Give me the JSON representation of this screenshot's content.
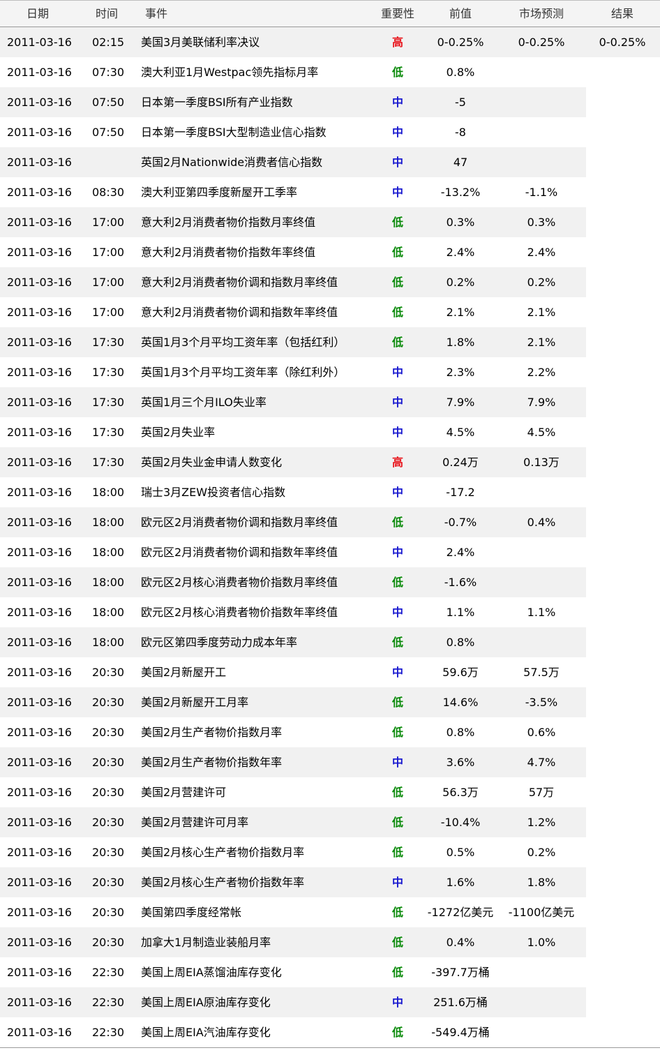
{
  "table": {
    "headers": {
      "date": "日期",
      "time": "时间",
      "event": "事件",
      "importance": "重要性",
      "previous": "前值",
      "forecast": "市场预测",
      "result": "结果"
    },
    "importance_colors": {
      "high": "#e8141b",
      "mid": "#1818cf",
      "low": "#0a8a0a"
    },
    "rows": [
      {
        "date": "2011-03-16",
        "time": "02:15",
        "event": "美国3月美联储利率决议",
        "importance": "高",
        "level": "high",
        "previous": "0-0.25%",
        "forecast": "0-0.25%",
        "result": "0-0.25%"
      },
      {
        "date": "2011-03-16",
        "time": "07:30",
        "event": "澳大利亚1月Westpac领先指标月率",
        "importance": "低",
        "level": "low",
        "previous": "0.8%",
        "forecast": "",
        "result": ""
      },
      {
        "date": "2011-03-16",
        "time": "07:50",
        "event": "日本第一季度BSI所有产业指数",
        "importance": "中",
        "level": "mid",
        "previous": "-5",
        "forecast": "",
        "result": ""
      },
      {
        "date": "2011-03-16",
        "time": "07:50",
        "event": "日本第一季度BSI大型制造业信心指数",
        "importance": "中",
        "level": "mid",
        "previous": "-8",
        "forecast": "",
        "result": ""
      },
      {
        "date": "2011-03-16",
        "time": "",
        "event": "英国2月Nationwide消费者信心指数",
        "importance": "中",
        "level": "mid",
        "previous": "47",
        "forecast": "",
        "result": ""
      },
      {
        "date": "2011-03-16",
        "time": "08:30",
        "event": "澳大利亚第四季度新屋开工季率",
        "importance": "中",
        "level": "mid",
        "previous": "-13.2%",
        "forecast": "-1.1%",
        "result": ""
      },
      {
        "date": "2011-03-16",
        "time": "17:00",
        "event": "意大利2月消费者物价指数月率终值",
        "importance": "低",
        "level": "low",
        "previous": "0.3%",
        "forecast": "0.3%",
        "result": ""
      },
      {
        "date": "2011-03-16",
        "time": "17:00",
        "event": "意大利2月消费者物价指数年率终值",
        "importance": "低",
        "level": "low",
        "previous": "2.4%",
        "forecast": "2.4%",
        "result": ""
      },
      {
        "date": "2011-03-16",
        "time": "17:00",
        "event": "意大利2月消费者物价调和指数月率终值",
        "importance": "低",
        "level": "low",
        "previous": "0.2%",
        "forecast": "0.2%",
        "result": ""
      },
      {
        "date": "2011-03-16",
        "time": "17:00",
        "event": "意大利2月消费者物价调和指数年率终值",
        "importance": "低",
        "level": "low",
        "previous": "2.1%",
        "forecast": "2.1%",
        "result": ""
      },
      {
        "date": "2011-03-16",
        "time": "17:30",
        "event": "英国1月3个月平均工资年率（包括红利）",
        "importance": "低",
        "level": "low",
        "previous": "1.8%",
        "forecast": "2.1%",
        "result": ""
      },
      {
        "date": "2011-03-16",
        "time": "17:30",
        "event": "英国1月3个月平均工资年率（除红利外）",
        "importance": "中",
        "level": "mid",
        "previous": "2.3%",
        "forecast": "2.2%",
        "result": ""
      },
      {
        "date": "2011-03-16",
        "time": "17:30",
        "event": "英国1月三个月ILO失业率",
        "importance": "中",
        "level": "mid",
        "previous": "7.9%",
        "forecast": "7.9%",
        "result": ""
      },
      {
        "date": "2011-03-16",
        "time": "17:30",
        "event": "英国2月失业率",
        "importance": "中",
        "level": "mid",
        "previous": "4.5%",
        "forecast": "4.5%",
        "result": ""
      },
      {
        "date": "2011-03-16",
        "time": "17:30",
        "event": "英国2月失业金申请人数变化",
        "importance": "高",
        "level": "high",
        "previous": "0.24万",
        "forecast": "0.13万",
        "result": ""
      },
      {
        "date": "2011-03-16",
        "time": "18:00",
        "event": "瑞士3月ZEW投资者信心指数",
        "importance": "中",
        "level": "mid",
        "previous": "-17.2",
        "forecast": "",
        "result": ""
      },
      {
        "date": "2011-03-16",
        "time": "18:00",
        "event": "欧元区2月消费者物价调和指数月率终值",
        "importance": "低",
        "level": "low",
        "previous": "-0.7%",
        "forecast": "0.4%",
        "result": ""
      },
      {
        "date": "2011-03-16",
        "time": "18:00",
        "event": "欧元区2月消费者物价调和指数年率终值",
        "importance": "中",
        "level": "mid",
        "previous": "2.4%",
        "forecast": "",
        "result": ""
      },
      {
        "date": "2011-03-16",
        "time": "18:00",
        "event": "欧元区2月核心消费者物价指数月率终值",
        "importance": "低",
        "level": "low",
        "previous": "-1.6%",
        "forecast": "",
        "result": ""
      },
      {
        "date": "2011-03-16",
        "time": "18:00",
        "event": "欧元区2月核心消费者物价指数年率终值",
        "importance": "中",
        "level": "mid",
        "previous": "1.1%",
        "forecast": "1.1%",
        "result": ""
      },
      {
        "date": "2011-03-16",
        "time": "18:00",
        "event": "欧元区第四季度劳动力成本年率",
        "importance": "低",
        "level": "low",
        "previous": "0.8%",
        "forecast": "",
        "result": ""
      },
      {
        "date": "2011-03-16",
        "time": "20:30",
        "event": "美国2月新屋开工",
        "importance": "中",
        "level": "mid",
        "previous": "59.6万",
        "forecast": "57.5万",
        "result": ""
      },
      {
        "date": "2011-03-16",
        "time": "20:30",
        "event": "美国2月新屋开工月率",
        "importance": "低",
        "level": "low",
        "previous": "14.6%",
        "forecast": "-3.5%",
        "result": ""
      },
      {
        "date": "2011-03-16",
        "time": "20:30",
        "event": "美国2月生产者物价指数月率",
        "importance": "低",
        "level": "low",
        "previous": "0.8%",
        "forecast": "0.6%",
        "result": ""
      },
      {
        "date": "2011-03-16",
        "time": "20:30",
        "event": "美国2月生产者物价指数年率",
        "importance": "中",
        "level": "mid",
        "previous": "3.6%",
        "forecast": "4.7%",
        "result": ""
      },
      {
        "date": "2011-03-16",
        "time": "20:30",
        "event": "美国2月营建许可",
        "importance": "低",
        "level": "low",
        "previous": "56.3万",
        "forecast": "57万",
        "result": ""
      },
      {
        "date": "2011-03-16",
        "time": "20:30",
        "event": "美国2月营建许可月率",
        "importance": "低",
        "level": "low",
        "previous": "-10.4%",
        "forecast": "1.2%",
        "result": ""
      },
      {
        "date": "2011-03-16",
        "time": "20:30",
        "event": "美国2月核心生产者物价指数月率",
        "importance": "低",
        "level": "low",
        "previous": "0.5%",
        "forecast": "0.2%",
        "result": ""
      },
      {
        "date": "2011-03-16",
        "time": "20:30",
        "event": "美国2月核心生产者物价指数年率",
        "importance": "中",
        "level": "mid",
        "previous": "1.6%",
        "forecast": "1.8%",
        "result": ""
      },
      {
        "date": "2011-03-16",
        "time": "20:30",
        "event": "美国第四季度经常帐",
        "importance": "低",
        "level": "low",
        "previous": "-1272亿美元",
        "forecast": "-1100亿美元",
        "result": ""
      },
      {
        "date": "2011-03-16",
        "time": "20:30",
        "event": "加拿大1月制造业装船月率",
        "importance": "低",
        "level": "low",
        "previous": "0.4%",
        "forecast": "1.0%",
        "result": ""
      },
      {
        "date": "2011-03-16",
        "time": "22:30",
        "event": "美国上周EIA蒸馏油库存变化",
        "importance": "低",
        "level": "low",
        "previous": "-397.7万桶",
        "forecast": "",
        "result": ""
      },
      {
        "date": "2011-03-16",
        "time": "22:30",
        "event": "美国上周EIA原油库存变化",
        "importance": "中",
        "level": "mid",
        "previous": "251.6万桶",
        "forecast": "",
        "result": ""
      },
      {
        "date": "2011-03-16",
        "time": "22:30",
        "event": "美国上周EIA汽油库存变化",
        "importance": "低",
        "level": "low",
        "previous": "-549.4万桶",
        "forecast": "",
        "result": ""
      }
    ]
  }
}
